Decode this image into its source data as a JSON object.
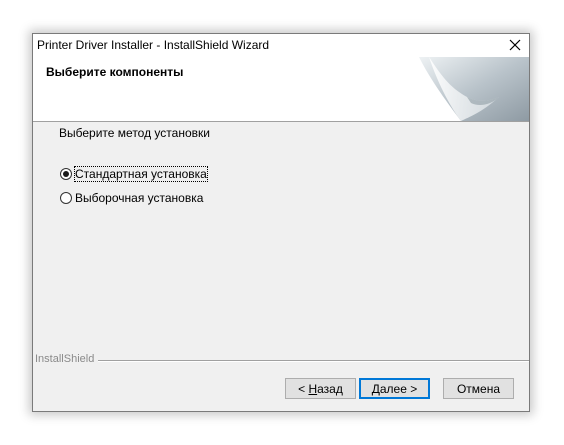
{
  "window": {
    "title": "Printer Driver Installer - InstallShield Wizard"
  },
  "header": {
    "title": "Выберите компоненты"
  },
  "body": {
    "prompt": "Выберите метод установки",
    "options": [
      {
        "label": "Стандартная установка",
        "selected": true
      },
      {
        "label": "Выборочная установка",
        "selected": false
      }
    ]
  },
  "footer": {
    "brand": "InstallShield",
    "buttons": {
      "back_prefix": "< ",
      "back_accel": "Н",
      "back_rest": "азад",
      "next_accel": "Д",
      "next_rest": "алее >",
      "cancel": "Отмена"
    }
  },
  "icons": {
    "close": "close-icon",
    "header_graphic": "page-curl-graphic"
  }
}
